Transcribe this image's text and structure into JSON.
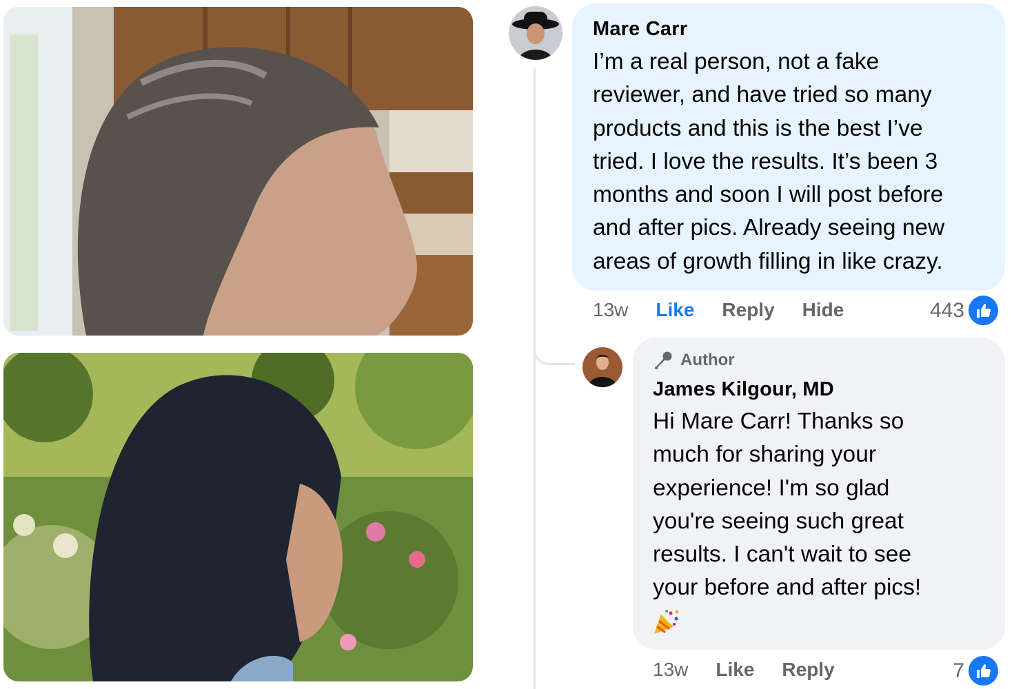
{
  "photos": {
    "before_alt": "Woman's thinning gray hair at kitchen",
    "after_alt": "Woman's dark full hair in garden"
  },
  "comment": {
    "author": "Mare Carr",
    "text": "I’m a real person, not a fake\nreviewer, and have tried so many\nproducts and this is the best I’ve\ntried. I love the results. It’s been 3\nmonths and soon I will post before\nand after pics. Already seeing new\nareas of growth filling in like crazy.",
    "time": "13w",
    "like_label": "Like",
    "reply_label": "Reply",
    "hide_label": "Hide",
    "reaction_count": "443"
  },
  "reply": {
    "badge": "Author",
    "author": "James Kilgour, MD",
    "text": "Hi Mare Carr! Thanks so\nmuch for sharing your\nexperience! I'm so glad\nyou're seeing such great\nresults. I can't wait to see\nyour before and after pics!",
    "emoji": "party-popper-icon",
    "time": "13w",
    "like_label": "Like",
    "reply_label": "Reply",
    "reaction_count": "7"
  },
  "colors": {
    "accent": "#1877f2",
    "comment_bubble": "#e7f3ff",
    "reply_bubble": "#f0f2f5",
    "muted_text": "#65676b"
  }
}
